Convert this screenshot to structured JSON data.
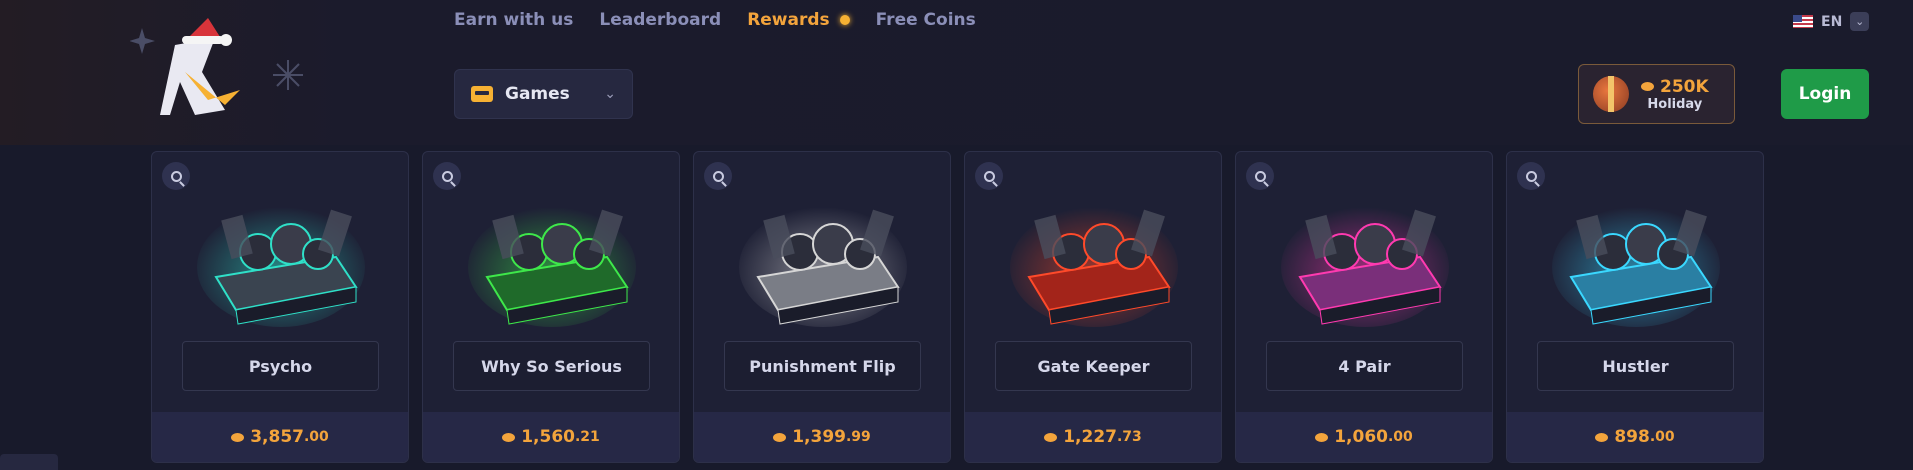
{
  "nav": {
    "items": [
      {
        "label": "Earn with us",
        "active": false
      },
      {
        "label": "Leaderboard",
        "active": false
      },
      {
        "label": "Rewards",
        "active": true
      },
      {
        "label": "Free Coins",
        "active": false
      }
    ]
  },
  "lang": {
    "code": "EN",
    "flag": "us-flag-icon"
  },
  "games_button": {
    "label": "Games",
    "icon": "gamepad-chest-icon"
  },
  "holiday": {
    "amount": "250K",
    "label": "Holiday"
  },
  "login": {
    "label": "Login"
  },
  "colors": {
    "accent": "#f3a43c",
    "login": "#1f9b48",
    "background": "#181a2b"
  },
  "cases": [
    {
      "name": "Psycho",
      "price_main": "3,857",
      "price_cents": ".00",
      "glow": "#2fe0c8",
      "case_color": "#3a4450"
    },
    {
      "name": "Why So Serious",
      "price_main": "1,560",
      "price_cents": ".21",
      "glow": "#3ee84a",
      "case_color": "#1f6a2a"
    },
    {
      "name": "Punishment Flip",
      "price_main": "1,399",
      "price_cents": ".99",
      "glow": "#d6d6d6",
      "case_color": "#7a7d86"
    },
    {
      "name": "Gate Keeper",
      "price_main": "1,227",
      "price_cents": ".73",
      "glow": "#ff4a2a",
      "case_color": "#a3241a"
    },
    {
      "name": "4 Pair",
      "price_main": "1,060",
      "price_cents": ".00",
      "glow": "#ff3ab0",
      "case_color": "#7a2f7a"
    },
    {
      "name": "Hustler",
      "price_main": "898",
      "price_cents": ".00",
      "glow": "#3ad8ff",
      "case_color": "#2a7fa3"
    }
  ]
}
